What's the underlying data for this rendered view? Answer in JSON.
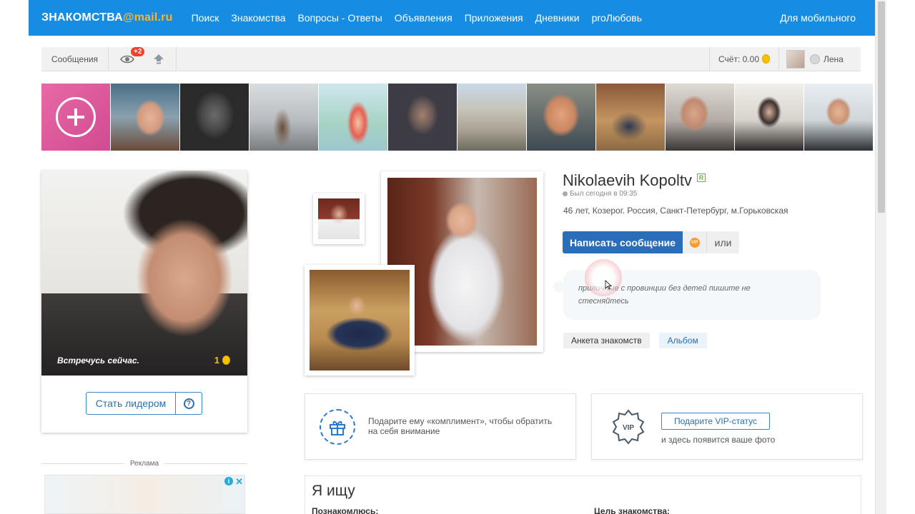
{
  "header": {
    "logo_main": "ЗНАКОМСТВА",
    "logo_accent": "@mail.ru",
    "nav": [
      "Поиск",
      "Знакомства",
      "Вопросы - Ответы",
      "Объявления",
      "Приложения",
      "Дневники",
      "proЛюбовь"
    ],
    "mobile": "Для мобильного"
  },
  "userbar": {
    "messages": "Сообщения",
    "guests_badge": "+2",
    "score": "Счёт: 0.00",
    "username": "Лена"
  },
  "promo": {
    "caption": "Встречусь сейчас.",
    "count": "1",
    "lead_button": "Стать лидером",
    "help_icon": "?"
  },
  "ad": {
    "label": "Реклама"
  },
  "profile": {
    "name": "Nikolaevih Kopoltv",
    "badge": "R",
    "last_seen": "Был сегодня в 09:35",
    "info": "46 лет, Козерог. Россия, Санкт-Петербург, м.Горьковская",
    "write_button": "Написать сообщение",
    "vip_icon": "VIP",
    "or_button": "или",
    "about": "приличные с провинции без детей пишите не стесняйтесь",
    "tab_profile": "Анкета знакомств",
    "tab_album": "Альбом"
  },
  "compliment": {
    "text": "Подарите ему «комплимент», чтобы обратить на себя внимание"
  },
  "vip": {
    "icon_text": "VIP",
    "button": "Подарите VIP-статус",
    "text": "и здесь появится ваше фото"
  },
  "seeking": {
    "title": "Я ищу",
    "col1": "Познакомлюсь:",
    "col2": "Цель знакомства:"
  },
  "colors": {
    "brand_blue": "#168de2",
    "accent_orange": "#ffb322",
    "primary_button": "#2a6db8",
    "promo_pink": "#e86aa6"
  }
}
